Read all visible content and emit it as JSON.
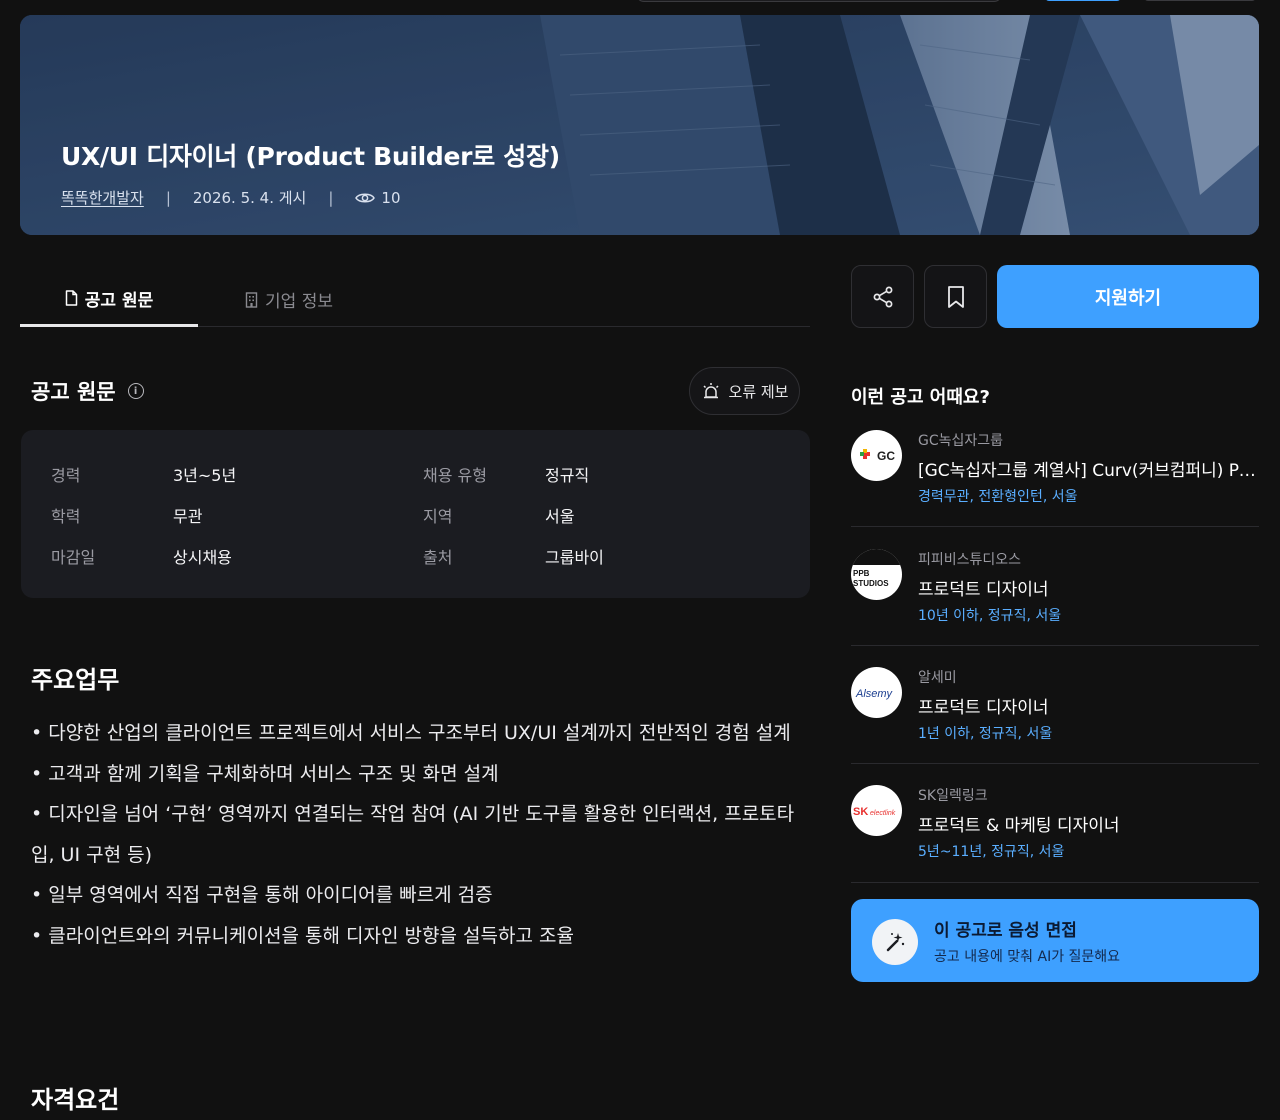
{
  "hero": {
    "title": "UX/UI 디자이너 (Product Builder로 성장)",
    "company": "똑똑한개발자",
    "posted": "2026. 5. 4. 게시",
    "views": "10",
    "separator": "|"
  },
  "tabs": [
    {
      "label": "공고 원문",
      "icon": "document-icon",
      "active": true
    },
    {
      "label": "기업 정보",
      "icon": "building-icon",
      "active": false
    }
  ],
  "section": {
    "title": "공고 원문",
    "report_label": "오류 제보"
  },
  "info": {
    "career_label": "경력",
    "career": "3년~5년",
    "type_label": "채용 유형",
    "type": "정규직",
    "edu_label": "학력",
    "edu": "무관",
    "region_label": "지역",
    "region": "서울",
    "deadline_label": "마감일",
    "deadline": "상시채용",
    "source_label": "출처",
    "source": "그룹바이"
  },
  "duties": {
    "title": "주요업무",
    "items": [
      "• 다양한 산업의 클라이언트 프로젝트에서 서비스 구조부터 UX/UI 설계까지 전반적인 경험 설계",
      "• 고객과 함께 기획을 구체화하며 서비스 구조 및 화면 설계",
      "• 디자인을 넘어 ‘구현’ 영역까지 연결되는 작업 참여 (AI 기반 도구를 활용한 인터랙션, 프로토타입, UI 구현 등)",
      "• 일부 영역에서 직접 구현을 통해 아이디어를 빠르게 검증",
      "• 클라이언트와의 커뮤니케이션을 통해 디자인 방향을 설득하고 조율"
    ]
  },
  "qualifications": {
    "title": "자격요건"
  },
  "actions": {
    "apply_label": "지원하기",
    "share_icon": "share-icon",
    "bookmark_icon": "bookmark-icon"
  },
  "recommend": {
    "title": "이런 공고 어때요?",
    "items": [
      {
        "company": "GC녹십자그룹",
        "job": "[GC녹십자그룹 계열사] Curv(커브컴퍼니) Pr...",
        "tags": "경력무관, 전환형인턴, 서울",
        "logo": "GC"
      },
      {
        "company": "피피비스튜디오스",
        "job": "프로덕트 디자이너",
        "tags": "10년 이하, 정규직, 서울",
        "logo": "PPB STUDIOS"
      },
      {
        "company": "알세미",
        "job": "프로덕트 디자이너",
        "tags": "1년 이하, 정규직, 서울",
        "logo": "Alsemy"
      },
      {
        "company": "SK일렉링크",
        "job": "프로덕트 & 마케팅 디자이너",
        "tags": "5년~11년, 정규직, 서울",
        "logo": "SK electlink"
      }
    ]
  },
  "voice": {
    "title": "이 공고로 음성 면접",
    "subtitle": "공고 내용에 맞춰 AI가 질문해요"
  },
  "colors": {
    "accent": "#3ea0ff",
    "background": "#111111",
    "tag": "#5aaeff"
  }
}
